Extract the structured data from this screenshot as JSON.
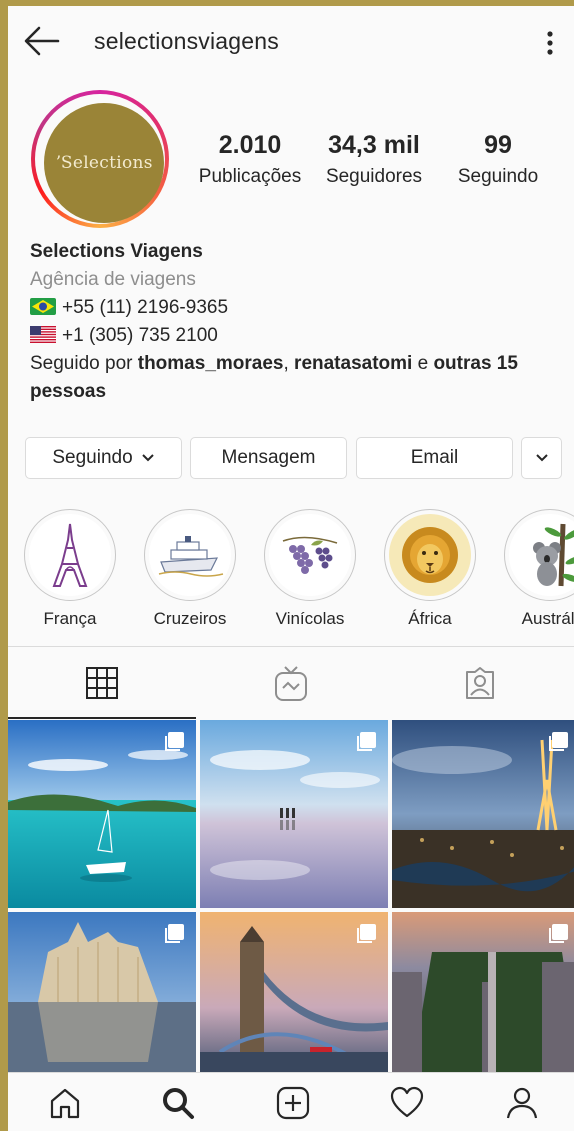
{
  "header": {
    "username": "selectionsviagens"
  },
  "profile": {
    "avatar_text": "ʼSelections",
    "stats": [
      {
        "value": "2.010",
        "label": "Publicações"
      },
      {
        "value": "34,3 mil",
        "label": "Seguidores"
      },
      {
        "value": "99",
        "label": "Seguindo"
      }
    ],
    "name": "Selections Viagens",
    "category": "Agência de viagens",
    "phone_br": "+55 (11) 2196-9365",
    "phone_us": "+1 (305) 735 2100",
    "followed_by_prefix": "Seguido por ",
    "followed_user_1": "thomas_moraes",
    "followed_sep": ", ",
    "followed_user_2": "renatasatomi",
    "followed_and": " e ",
    "followed_others": "outras 15 pessoas"
  },
  "buttons": {
    "following": "Seguindo",
    "message": "Mensagem",
    "email": "Email"
  },
  "highlights": [
    {
      "label": "França",
      "icon": "eiffel-tower-icon"
    },
    {
      "label": "Cruzeiros",
      "icon": "cruise-ship-icon"
    },
    {
      "label": "Vinícolas",
      "icon": "grapes-icon"
    },
    {
      "label": "África",
      "icon": "lion-icon"
    },
    {
      "label": "Austráli",
      "icon": "koala-icon"
    }
  ],
  "tabs": [
    "grid-icon",
    "igtv-icon",
    "tagged-icon"
  ],
  "bottom_nav": [
    "home-icon",
    "search-icon",
    "add-post-icon",
    "activity-heart-icon",
    "profile-icon"
  ],
  "colors": {
    "accent": "#262626",
    "brand_gold": "#9a8437",
    "frame": "#b09a4a"
  }
}
